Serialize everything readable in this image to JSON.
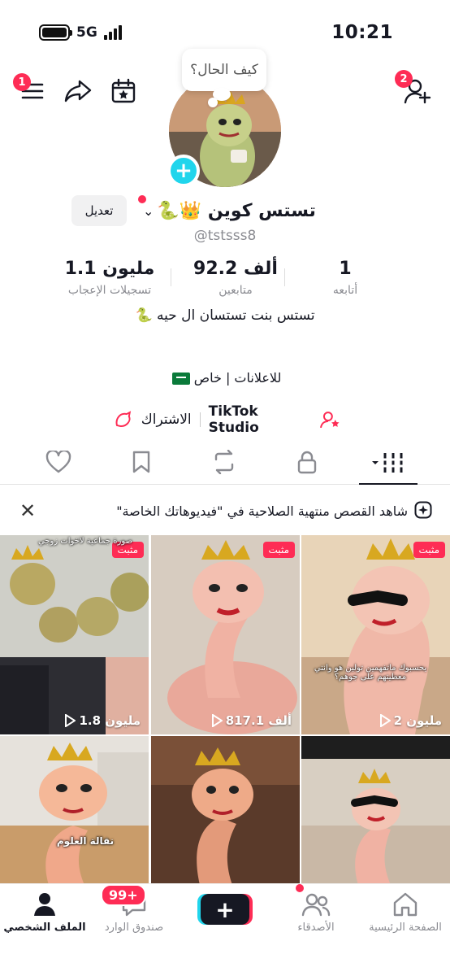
{
  "status_bar": {
    "time": "10:21",
    "network": "5G"
  },
  "top_bar": {
    "menu_badge": "1",
    "add_friend_badge": "2"
  },
  "profile": {
    "bubble_text": "كيف الحال؟",
    "edit_label": "تعديل",
    "name": "تستس كوين 👑🐍",
    "handle": "@tstsss8",
    "stats": [
      {
        "value": "1",
        "label": "أتابعه"
      },
      {
        "value": "92.2 ألف",
        "label": "متابعين"
      },
      {
        "value": "1.1 مليون",
        "label": "تسجيلات الإعجاب"
      }
    ],
    "bio": "تستس بنت تستسان ال حيه 🐍",
    "ads_line": "للاعلانات | خاص",
    "studio_label": "TikTok Studio",
    "subscribe_label": "الاشتراك"
  },
  "tabs": [
    "videos",
    "private",
    "reposts",
    "favorites",
    "liked"
  ],
  "banner": {
    "text": "شاهد القصص منتهية الصلاحية في \"فيديوهاتك الخاصة\""
  },
  "videos": [
    {
      "pinned": "مثبت",
      "views": "2 مليون",
      "caption": "يحسبوك ماتفهمين تولين هو وانتي معطيتهم على جوهم؟"
    },
    {
      "pinned": "مثبت",
      "views": "817.1 ألف",
      "caption": ""
    },
    {
      "pinned": "مثبت",
      "views": "1.8 مليون",
      "caption": "صورة جماعية لاخوات زوجي"
    },
    {
      "pinned": "",
      "views": "",
      "caption": ""
    },
    {
      "pinned": "",
      "views": "",
      "caption": ""
    },
    {
      "pinned": "",
      "views": "",
      "caption": "نقالة العلوم"
    }
  ],
  "bottom_nav": {
    "home": "الصفحة الرئيسية",
    "friends": "الأصدقاء",
    "inbox": "صندوق الوارد",
    "inbox_badge": "99+",
    "profile": "الملف الشخصي"
  },
  "colors": {
    "accent": "#fe2c55",
    "cyan": "#20d5ec",
    "text": "#161823",
    "muted": "#8a8b91"
  }
}
